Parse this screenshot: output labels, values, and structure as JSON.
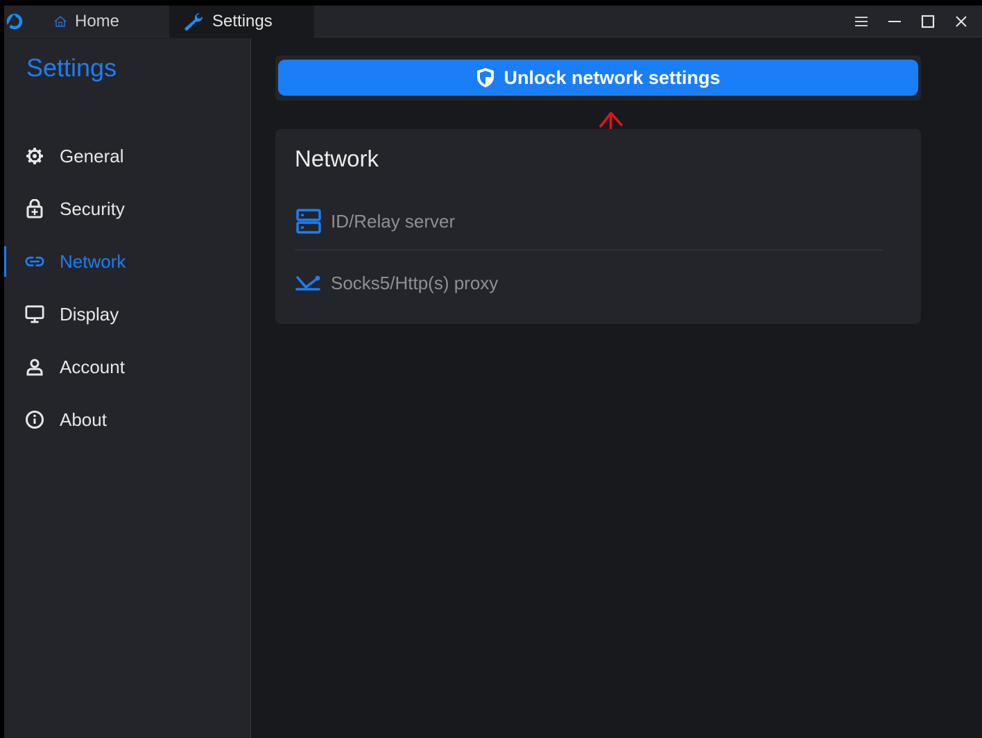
{
  "titlebar": {
    "tabs": [
      {
        "label": "Home",
        "icon": "home-icon"
      },
      {
        "label": "Settings",
        "icon": "wrench-icon"
      }
    ],
    "controls": [
      "menu-icon",
      "minimize-icon",
      "maximize-icon",
      "close-icon"
    ]
  },
  "sidebar": {
    "title": "Settings",
    "items": [
      {
        "label": "General",
        "icon": "gear-icon"
      },
      {
        "label": "Security",
        "icon": "lock-icon"
      },
      {
        "label": "Network",
        "icon": "link-icon",
        "active": true
      },
      {
        "label": "Display",
        "icon": "monitor-icon"
      },
      {
        "label": "Account",
        "icon": "person-icon"
      },
      {
        "label": "About",
        "icon": "info-icon"
      }
    ]
  },
  "main": {
    "unlock_button": {
      "label": "Unlock network settings",
      "icon": "shield-icon"
    },
    "network_card": {
      "title": "Network",
      "rows": [
        {
          "label": "ID/Relay server",
          "icon": "server-icon"
        },
        {
          "label": "Socks5/Http(s) proxy",
          "icon": "proxy-icon"
        }
      ]
    }
  },
  "colors": {
    "accent": "#1a7ef7",
    "window_bg": "#18191d",
    "panel_bg": "#24252a",
    "annotation": "#e0141b"
  }
}
